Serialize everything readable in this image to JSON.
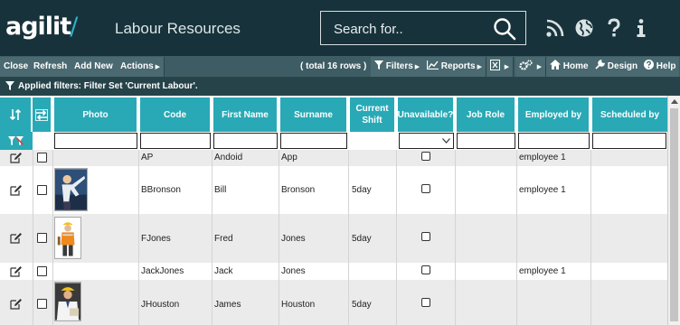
{
  "header": {
    "logo": "agilit",
    "logo_accent": "/",
    "title": "Labour Resources",
    "search_placeholder": "Search for..",
    "icons": [
      "rss-icon",
      "globe-icon",
      "help-icon",
      "info-icon"
    ]
  },
  "toolbar": {
    "close": "Close",
    "refresh": "Refresh",
    "add_new": "Add New",
    "actions": "Actions",
    "total": "( total 16 rows )",
    "filters": "Filters",
    "reports": "Reports",
    "home": "Home",
    "design": "Design",
    "help": "Help"
  },
  "filter_bar": {
    "text": "Applied filters: Filter Set 'Current Labour'."
  },
  "columns": {
    "photo": "Photo",
    "code": "Code",
    "first_name": "First Name",
    "surname": "Surname",
    "current_shift": "Current Shift",
    "unavailable": "Unavailable?",
    "job_role": "Job Role",
    "employed_by": "Employed by",
    "scheduled_by": "Scheduled by"
  },
  "rows": [
    {
      "code": "AP",
      "first_name": "Andoid",
      "surname": "App",
      "shift": "",
      "employed_by": "employee 1",
      "photo": ""
    },
    {
      "code": "BBronson",
      "first_name": "Bill",
      "surname": "Bronson",
      "shift": "5day",
      "employed_by": "employee 1",
      "photo": "worker-photo"
    },
    {
      "code": "FJones",
      "first_name": "Fred",
      "surname": "Jones",
      "shift": "5day",
      "employed_by": "",
      "photo": "worker-photo"
    },
    {
      "code": "JackJones",
      "first_name": "Jack",
      "surname": "Jones",
      "shift": "",
      "employed_by": "employee 1",
      "photo": ""
    },
    {
      "code": "JHouston",
      "first_name": "James",
      "surname": "Houston",
      "shift": "5day",
      "employed_by": "",
      "photo": "worker-photo"
    }
  ],
  "colors": {
    "header_bg": "#17323a",
    "toolbar_bg": "#3e5c63",
    "column_header_bg": "#29a9b6",
    "row_alt_bg": "#ebebeb"
  }
}
